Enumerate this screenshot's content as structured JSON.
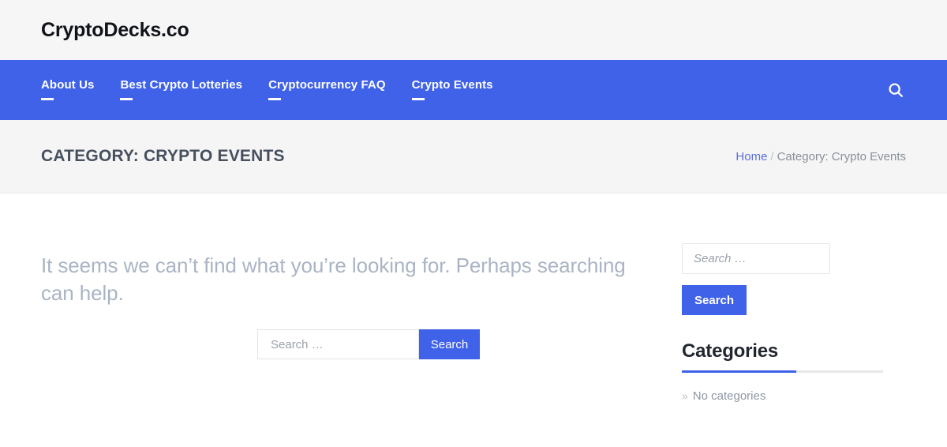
{
  "header": {
    "site_title": "CryptoDecks.co"
  },
  "nav": {
    "items": [
      {
        "label": "About Us"
      },
      {
        "label": "Best Crypto Lotteries"
      },
      {
        "label": "Cryptocurrency FAQ"
      },
      {
        "label": "Crypto Events"
      }
    ],
    "search_icon": "search-icon"
  },
  "page_band": {
    "title": "CATEGORY: CRYPTO EVENTS",
    "breadcrumb": {
      "home": "Home",
      "separator": "/",
      "current": "Category: Crypto Events"
    }
  },
  "main": {
    "not_found_message": "It seems we can’t find what you’re looking for. Perhaps searching can help.",
    "search": {
      "value": "",
      "placeholder": "Search …",
      "button_label": "Search"
    }
  },
  "sidebar": {
    "search_widget": {
      "value": "",
      "placeholder": "Search …",
      "button_label": "Search"
    },
    "categories_widget": {
      "title": "Categories",
      "items": [
        {
          "chevron": "»",
          "label": "No categories"
        }
      ]
    }
  },
  "colors": {
    "accent_blue": "#3f62e8",
    "header_bg": "#f6f6f6",
    "band_bg": "#f5f5f6",
    "title_text": "#46505e",
    "muted_text": "#aab4c4",
    "link_blue": "#5b6ee0"
  }
}
